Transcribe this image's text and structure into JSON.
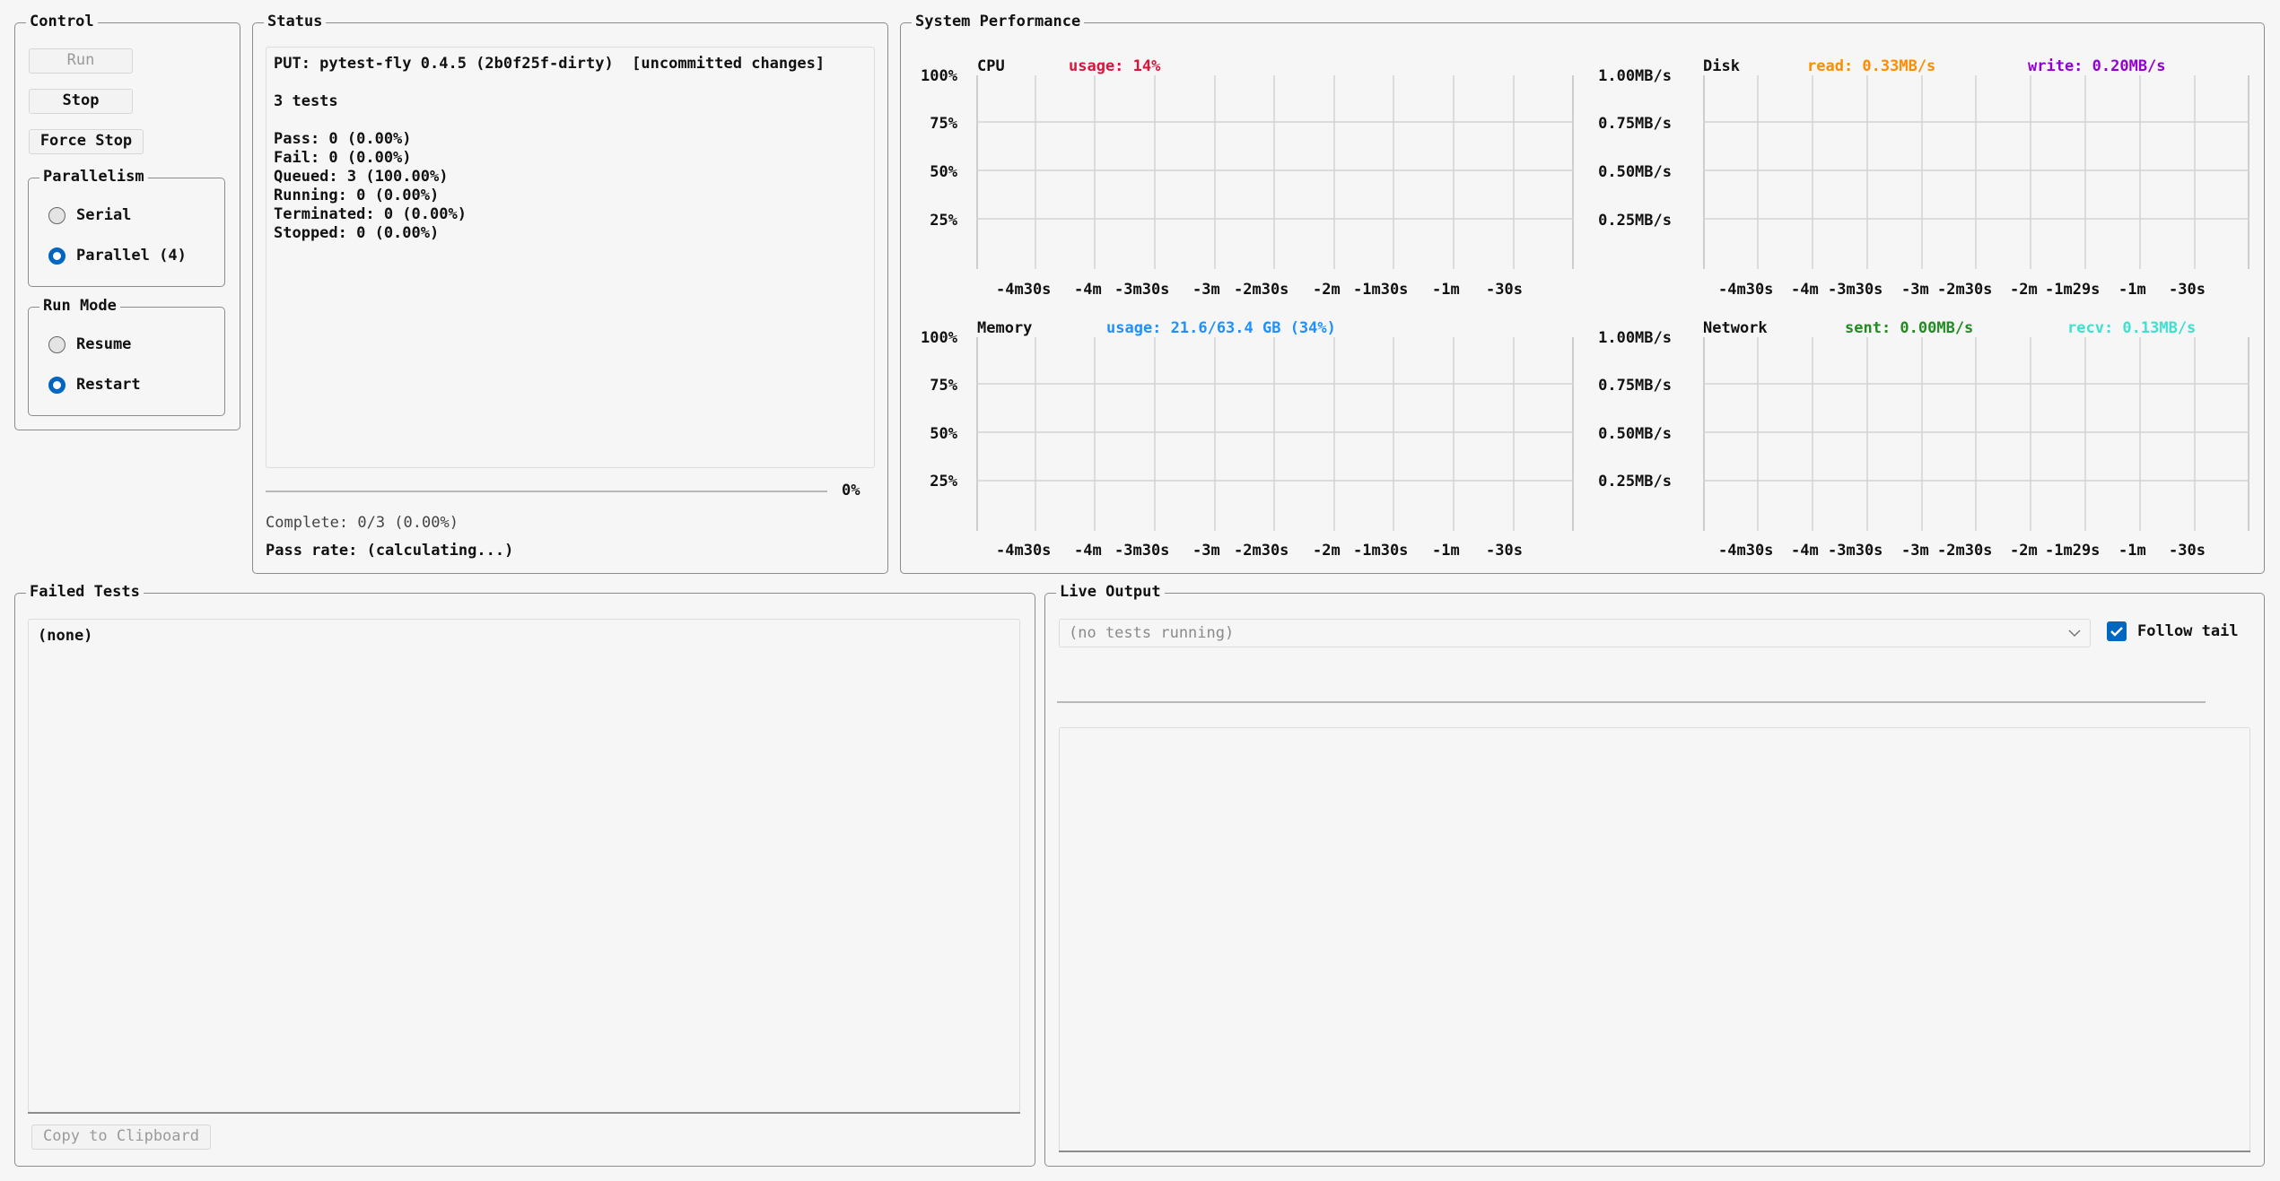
{
  "control": {
    "title": "Control",
    "run_label": "Run",
    "stop_label": "Stop",
    "force_stop_label": "Force Stop",
    "parallelism": {
      "title": "Parallelism",
      "serial_label": "Serial",
      "parallel_label": "Parallel (4)",
      "selected": "parallel"
    },
    "run_mode": {
      "title": "Run Mode",
      "resume_label": "Resume",
      "restart_label": "Restart",
      "selected": "restart"
    }
  },
  "status": {
    "title": "Status",
    "put_line": "PUT: pytest-fly 0.4.5 (2b0f25f-dirty)  [uncommitted changes]",
    "tests_count": "3 tests",
    "pass": "Pass: 0 (0.00%)",
    "fail": "Fail: 0 (0.00%)",
    "queued": "Queued: 3 (100.00%)",
    "running": "Running: 0 (0.00%)",
    "terminated": "Terminated: 0 (0.00%)",
    "stopped": "Stopped: 0 (0.00%)",
    "progress_percent": "0%",
    "progress_value": 0,
    "complete": "Complete: 0/3 (0.00%)",
    "pass_rate": "Pass rate: (calculating...)"
  },
  "performance": {
    "title": "System Performance",
    "x_ticks_a": [
      "-4m30s",
      "-4m",
      "-3m30s",
      "-3m",
      "-2m30s",
      "-2m",
      "-1m30s",
      "-1m",
      "-30s"
    ],
    "x_ticks_b": [
      "-4m30s",
      "-4m",
      "-3m30s",
      "-3m",
      "-2m30s",
      "-2m",
      "-1m29s",
      "-1m",
      "-30s"
    ],
    "y_ticks_pct": [
      "100%",
      "75%",
      "50%",
      "25%"
    ],
    "y_ticks_mbs": [
      "1.00MB/s",
      "0.75MB/s",
      "0.50MB/s",
      "0.25MB/s"
    ],
    "cpu": {
      "title": "CPU",
      "usage": "usage: 14%",
      "color": "#dc143c"
    },
    "disk": {
      "title": "Disk",
      "read": "read: 0.33MB/s",
      "read_color": "#ff8c00",
      "write": "write: 0.20MB/s",
      "write_color": "#9400d3"
    },
    "memory": {
      "title": "Memory",
      "usage": "usage: 21.6/63.4 GB (34%)",
      "color": "#1e90ff"
    },
    "network": {
      "title": "Network",
      "sent": "sent: 0.00MB/s",
      "sent_color": "#228b22",
      "recv": "recv: 0.13MB/s",
      "recv_color": "#40e0d0"
    }
  },
  "failed_tests": {
    "title": "Failed Tests",
    "content": "(none)",
    "copy_label": "Copy to Clipboard"
  },
  "live_output": {
    "title": "Live Output",
    "select_value": "(no tests running)",
    "follow_tail_label": "Follow tail",
    "follow_tail_checked": true
  }
}
